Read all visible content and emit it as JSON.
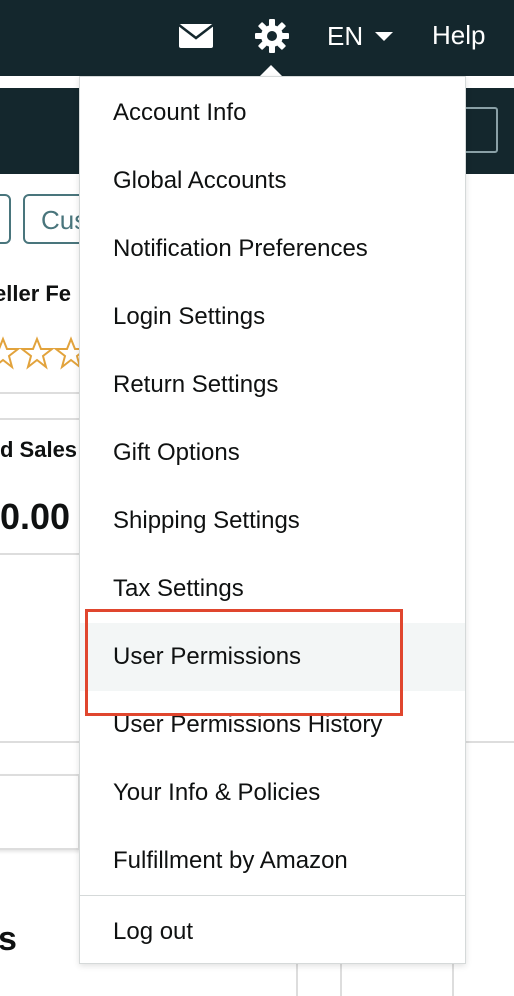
{
  "header": {
    "mail_icon": "mail-icon",
    "settings_icon": "gear-icon",
    "language": "EN",
    "help": "Help"
  },
  "background": {
    "button_label": "Cus",
    "feedback_title": "eller Fe",
    "sales_label": "d Sales",
    "sales_value": "0.00",
    "section_letter": "s",
    "star_color": "#e2a33c"
  },
  "menu": {
    "items": [
      {
        "label": "Account Info"
      },
      {
        "label": "Global Accounts"
      },
      {
        "label": "Notification Preferences"
      },
      {
        "label": "Login Settings"
      },
      {
        "label": "Return Settings"
      },
      {
        "label": "Gift Options"
      },
      {
        "label": "Shipping Settings"
      },
      {
        "label": "Tax Settings"
      },
      {
        "label": "User Permissions"
      },
      {
        "label": "User Permissions History"
      },
      {
        "label": "Your Info & Policies"
      },
      {
        "label": "Fulfillment by Amazon"
      }
    ],
    "logout": "Log out",
    "highlighted_item": "User Permissions"
  },
  "colors": {
    "header_bg": "#14272d",
    "highlight_border": "#e0462e",
    "hover_bg": "#f3f6f6"
  }
}
